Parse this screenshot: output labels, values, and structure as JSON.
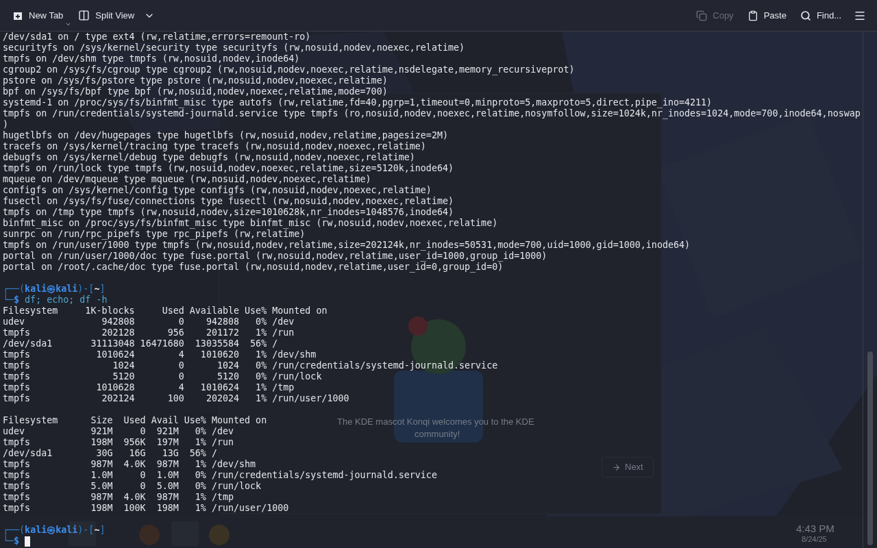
{
  "toolbar": {
    "left": [
      {
        "kind": "new_tab",
        "label": "New Tab",
        "disabled": false
      },
      {
        "kind": "split_view",
        "label": "Split View",
        "disabled": false
      }
    ],
    "right": [
      {
        "kind": "copy",
        "label": "Copy",
        "disabled": true
      },
      {
        "kind": "paste",
        "label": "Paste",
        "disabled": false
      },
      {
        "kind": "find",
        "label": "Find...",
        "disabled": false
      }
    ]
  },
  "background": {
    "caption": "The KDE mascot Konqi welcomes you to the KDE",
    "caption_2": "community!",
    "next_button": "Next",
    "clock_time": "4:43 PM",
    "clock_date": "8/24/25"
  },
  "terminal": {
    "lines": [
      {
        "kind": "output",
        "text": "/dev/sda1 on / type ext4 (rw,relatime,errors=remount-ro)"
      },
      {
        "kind": "output",
        "text": "securityfs on /sys/kernel/security type securityfs (rw,nosuid,nodev,noexec,relatime)"
      },
      {
        "kind": "output",
        "text": "tmpfs on /dev/shm type tmpfs (rw,nosuid,nodev,inode64)"
      },
      {
        "kind": "output",
        "text": "cgroup2 on /sys/fs/cgroup type cgroup2 (rw,nosuid,nodev,noexec,relatime,nsdelegate,memory_recursiveprot)"
      },
      {
        "kind": "output",
        "text": "pstore on /sys/fs/pstore type pstore (rw,nosuid,nodev,noexec,relatime)"
      },
      {
        "kind": "output",
        "text": "bpf on /sys/fs/bpf type bpf (rw,nosuid,nodev,noexec,relatime,mode=700)"
      },
      {
        "kind": "output",
        "text": "systemd-1 on /proc/sys/fs/binfmt_misc type autofs (rw,relatime,fd=40,pgrp=1,timeout=0,minproto=5,maxproto=5,direct,pipe_ino=4211)"
      },
      {
        "kind": "output",
        "text": "tmpfs on /run/credentials/systemd-journald.service type tmpfs (ro,nosuid,nodev,noexec,relatime,nosymfollow,size=1024k,nr_inodes=1024,mode=700,inode64,noswap"
      },
      {
        "kind": "output",
        "text": ")"
      },
      {
        "kind": "output",
        "text": "hugetlbfs on /dev/hugepages type hugetlbfs (rw,nosuid,nodev,relatime,pagesize=2M)"
      },
      {
        "kind": "output",
        "text": "tracefs on /sys/kernel/tracing type tracefs (rw,nosuid,nodev,noexec,relatime)"
      },
      {
        "kind": "output",
        "text": "debugfs on /sys/kernel/debug type debugfs (rw,nosuid,nodev,noexec,relatime)"
      },
      {
        "kind": "output",
        "text": "tmpfs on /run/lock type tmpfs (rw,nosuid,nodev,noexec,relatime,size=5120k,inode64)"
      },
      {
        "kind": "output",
        "text": "mqueue on /dev/mqueue type mqueue (rw,nosuid,nodev,noexec,relatime)"
      },
      {
        "kind": "output",
        "text": "configfs on /sys/kernel/config type configfs (rw,nosuid,nodev,noexec,relatime)"
      },
      {
        "kind": "output",
        "text": "fusectl on /sys/fs/fuse/connections type fusectl (rw,nosuid,nodev,noexec,relatime)"
      },
      {
        "kind": "output",
        "text": "tmpfs on /tmp type tmpfs (rw,nosuid,nodev,size=1010628k,nr_inodes=1048576,inode64)"
      },
      {
        "kind": "output",
        "text": "binfmt_misc on /proc/sys/fs/binfmt_misc type binfmt_misc (rw,nosuid,nodev,noexec,relatime)"
      },
      {
        "kind": "output",
        "text": "sunrpc on /run/rpc_pipefs type rpc_pipefs (rw,relatime)"
      },
      {
        "kind": "output",
        "text": "tmpfs on /run/user/1000 type tmpfs (rw,nosuid,nodev,relatime,size=202124k,nr_inodes=50531,mode=700,uid=1000,gid=1000,inode64)"
      },
      {
        "kind": "output",
        "text": "portal on /run/user/1000/doc type fuse.portal (rw,nosuid,nodev,relatime,user_id=1000,group_id=1000)"
      },
      {
        "kind": "output",
        "text": "portal on /root/.cache/doc type fuse.portal (rw,nosuid,nodev,relatime,user_id=0,group_id=0)"
      },
      {
        "kind": "blank"
      },
      {
        "kind": "prompt_top",
        "open": "┌──(",
        "user": "kali㉿kali",
        "mid": ")-[",
        "dir": "~",
        "close": "]"
      },
      {
        "kind": "prompt_bottom",
        "corner": "└─",
        "sign": "$",
        "command": "df; echo; df -h",
        "cursor": false
      },
      {
        "kind": "output",
        "text": "Filesystem     1K-blocks     Used Available Use% Mounted on"
      },
      {
        "kind": "output",
        "text": "udev              942808        0    942808   0% /dev"
      },
      {
        "kind": "output",
        "text": "tmpfs             202128      956    201172   1% /run"
      },
      {
        "kind": "output",
        "text": "/dev/sda1       31113048 16471680  13035584  56% /"
      },
      {
        "kind": "output",
        "text": "tmpfs            1010624        4   1010620   1% /dev/shm"
      },
      {
        "kind": "output",
        "text": "tmpfs               1024        0      1024   0% /run/credentials/systemd-journald.service"
      },
      {
        "kind": "output",
        "text": "tmpfs               5120        0      5120   0% /run/lock"
      },
      {
        "kind": "output",
        "text": "tmpfs            1010628        4   1010624   1% /tmp"
      },
      {
        "kind": "output",
        "text": "tmpfs             202124      100    202024   1% /run/user/1000"
      },
      {
        "kind": "blank"
      },
      {
        "kind": "output",
        "text": "Filesystem      Size  Used Avail Use% Mounted on"
      },
      {
        "kind": "output",
        "text": "udev            921M     0  921M   0% /dev"
      },
      {
        "kind": "output",
        "text": "tmpfs           198M  956K  197M   1% /run"
      },
      {
        "kind": "output",
        "text": "/dev/sda1        30G   16G   13G  56% /"
      },
      {
        "kind": "output",
        "text": "tmpfs           987M  4.0K  987M   1% /dev/shm"
      },
      {
        "kind": "output",
        "text": "tmpfs           1.0M     0  1.0M   0% /run/credentials/systemd-journald.service"
      },
      {
        "kind": "output",
        "text": "tmpfs           5.0M     0  5.0M   0% /run/lock"
      },
      {
        "kind": "output",
        "text": "tmpfs           987M  4.0K  987M   1% /tmp"
      },
      {
        "kind": "output",
        "text": "tmpfs           198M  100K  198M   1% /run/user/1000"
      },
      {
        "kind": "blank"
      },
      {
        "kind": "prompt_top",
        "open": "┌──(",
        "user": "kali㉿kali",
        "mid": ")-[",
        "dir": "~",
        "close": "]"
      },
      {
        "kind": "prompt_bottom",
        "corner": "└─",
        "sign": "$",
        "cursor": true
      }
    ]
  }
}
